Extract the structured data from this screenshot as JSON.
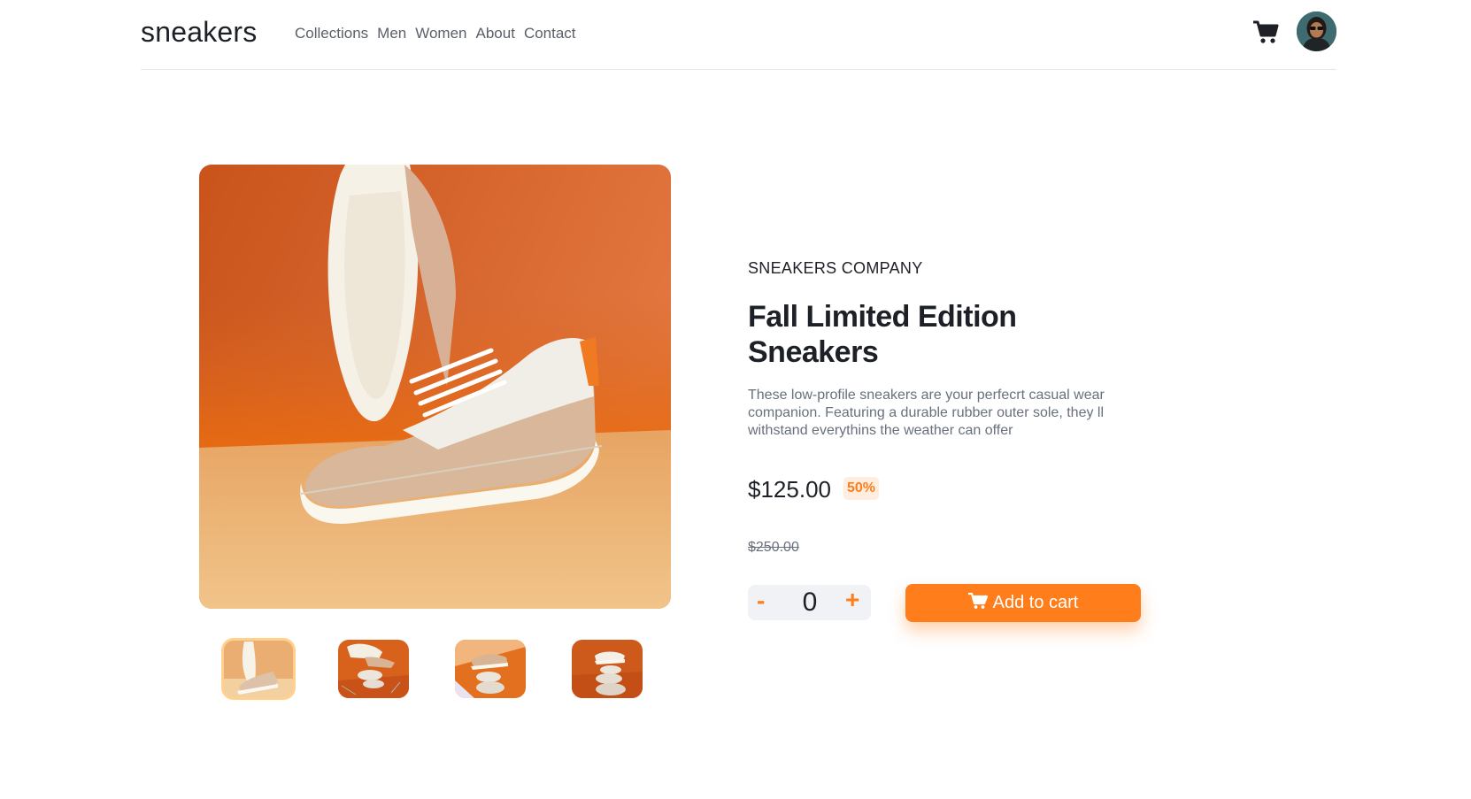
{
  "header": {
    "logo": "sneakers",
    "nav": [
      "Collections",
      "Men",
      "Women",
      "About",
      "Contact"
    ],
    "cart_icon": "cart-icon",
    "avatar_icon": "user-avatar"
  },
  "product": {
    "company": "SNEAKERS COMPANY",
    "title": "Fall Limited Edition Sneakers",
    "description": "These low-profile sneakers are your perfecrt casual wear companion. Featuring a durable rubber outer sole, they ll withstand everythins the weather can offer",
    "price": "$125.00",
    "discount": "50%",
    "original_price": "$250.00"
  },
  "quantity": {
    "minus": "-",
    "value": "0",
    "plus": "+"
  },
  "add_to_cart": {
    "label": "Add to cart"
  },
  "colors": {
    "accent": "#ff7d1a",
    "accent_pale": "#ffede0",
    "text_dark": "#1d2026",
    "text_muted": "#68707d"
  }
}
